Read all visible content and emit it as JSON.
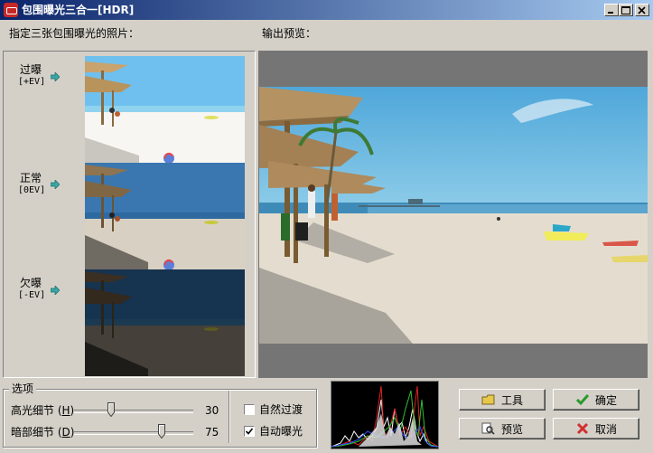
{
  "window": {
    "title": "包围曝光三合一[HDR]",
    "colors": {
      "title_start": "#0a246a",
      "title_end": "#a6caf0",
      "face": "#d4d0c8"
    }
  },
  "labels": {
    "source_photos": "指定三张包围曝光的照片：",
    "output_preview": "输出预览："
  },
  "exposures": [
    {
      "name": "过曝",
      "ev": "[+EV]",
      "icon": "arrow-right-icon"
    },
    {
      "name": "正常",
      "ev": "[0EV]",
      "icon": "arrow-right-icon"
    },
    {
      "name": "欠曝",
      "ev": "[-EV]",
      "icon": "arrow-right-icon"
    }
  ],
  "options": {
    "title": "选项",
    "highlight": {
      "label": "高光细节",
      "hotkey": "H",
      "value": "30",
      "level": 0.3
    },
    "shadow": {
      "label": "暗部细节",
      "hotkey": "D",
      "value": "75",
      "level": 0.75
    },
    "natural_transition": {
      "label": "自然过渡",
      "checked": false
    },
    "auto_exposure": {
      "label": "自动曝光",
      "checked": true
    }
  },
  "buttons": {
    "tools": "工具",
    "confirm": "确定",
    "preview": "预览",
    "cancel": "取消"
  }
}
